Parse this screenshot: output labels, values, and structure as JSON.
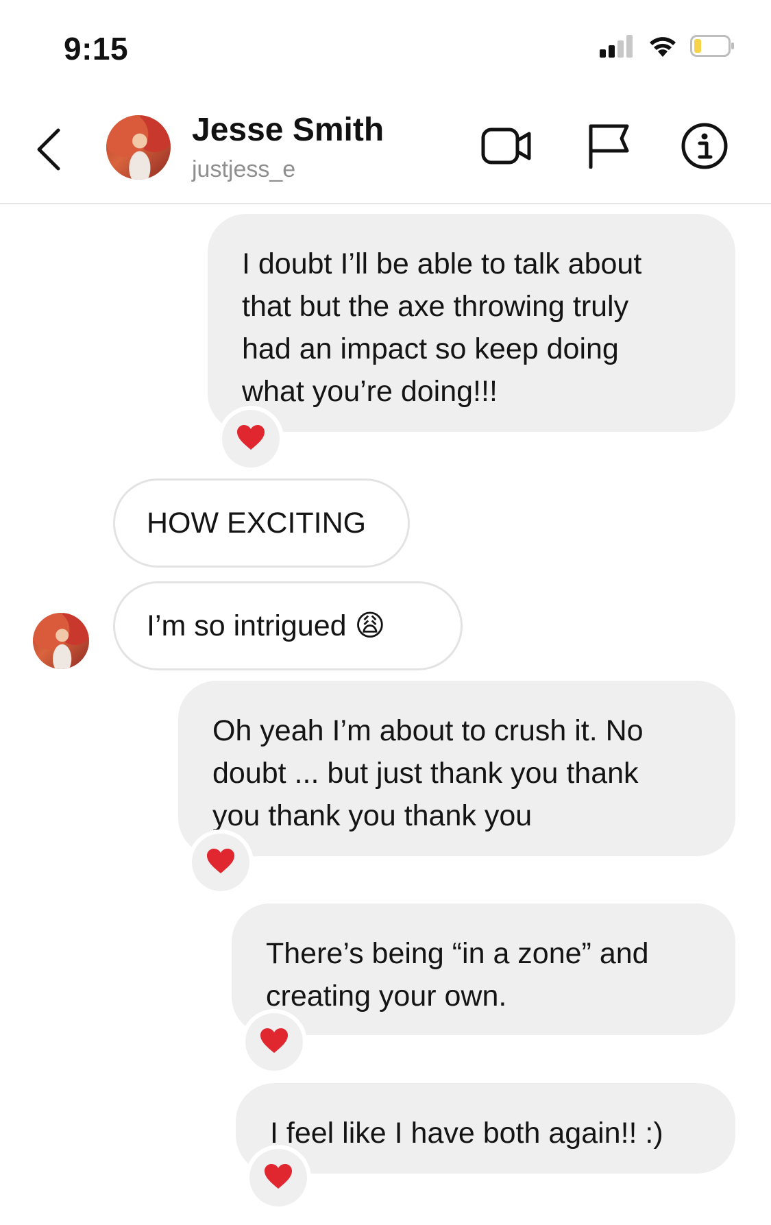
{
  "status_bar": {
    "time": "9:15"
  },
  "header": {
    "name": "Jesse Smith",
    "username": "justjess_e",
    "icons": [
      "back-chevron-icon",
      "video-call-icon",
      "flag-icon",
      "info-icon"
    ]
  },
  "messages": [
    {
      "direction": "outgoing",
      "text": "I doubt I’ll be able to talk about\nthat but the axe throwing truly\nhad an impact so keep doing\nwhat you’re doing!!!",
      "reaction": "❤️"
    },
    {
      "direction": "incoming",
      "text": "HOW EXCITING"
    },
    {
      "direction": "incoming",
      "text": "I’m so intrigued 😩"
    },
    {
      "direction": "outgoing",
      "text": "Oh yeah I’m about to crush it. No\ndoubt ... but just thank you thank\nyou thank you thank you",
      "reaction": "❤️"
    },
    {
      "direction": "outgoing",
      "text": "There’s being “in a zone” and\ncreating your own.",
      "reaction": "❤️"
    },
    {
      "direction": "outgoing",
      "text": "I feel like I have both again!! :)",
      "reaction": "❤️"
    }
  ],
  "colors": {
    "outgoing_bubble": "#efefef",
    "incoming_border": "#e3e3e3",
    "username_gray": "#8e8e8e",
    "battery_yellow": "#f7d34a",
    "heart_red": "#e0262f"
  }
}
